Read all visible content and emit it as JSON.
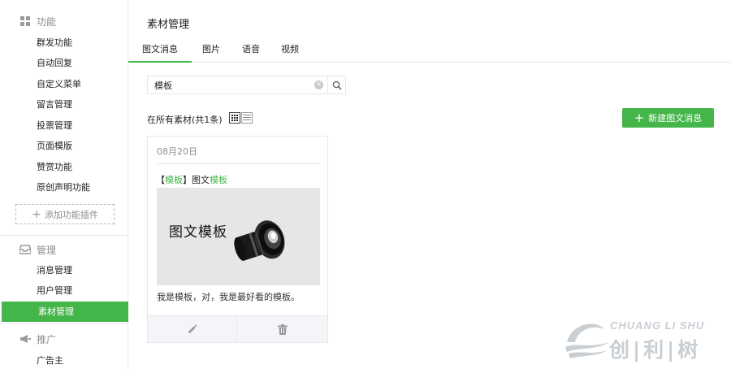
{
  "sidebar": {
    "group_features": {
      "label": "功能",
      "icon": "grid-icon"
    },
    "features": [
      {
        "label": "群发功能"
      },
      {
        "label": "自动回复"
      },
      {
        "label": "自定义菜单"
      },
      {
        "label": "留言管理"
      },
      {
        "label": "投票管理"
      },
      {
        "label": "页面模版"
      },
      {
        "label": "赞赏功能"
      },
      {
        "label": "原创声明功能"
      }
    ],
    "add_plugin": "添加功能插件",
    "group_manage": {
      "label": "管理",
      "icon": "inbox-icon"
    },
    "manage": [
      {
        "label": "消息管理"
      },
      {
        "label": "用户管理"
      },
      {
        "label": "素材管理",
        "active": true
      }
    ],
    "group_promo": {
      "label": "推广",
      "icon": "megaphone-icon"
    },
    "promo": [
      {
        "label": "广告主"
      }
    ]
  },
  "main": {
    "title": "素材管理",
    "tabs": [
      {
        "label": "图文消息",
        "active": true
      },
      {
        "label": "图片"
      },
      {
        "label": "语音"
      },
      {
        "label": "视频"
      }
    ],
    "search": {
      "value": "模板",
      "placeholder": ""
    },
    "count_label": "在所有素材(共1条)",
    "new_button": "新建图文消息",
    "accent_color": "#44b549"
  },
  "card": {
    "date": "08月20日",
    "title_open": "【",
    "title_hl1": "模板",
    "title_mid": "】图文",
    "title_hl2": "模板",
    "image_text": "图文模板",
    "description": "我是模板，对，我是最好看的模板。"
  },
  "watermark": {
    "en": "CHUANG LI SHU",
    "cn": "创|利|树"
  }
}
